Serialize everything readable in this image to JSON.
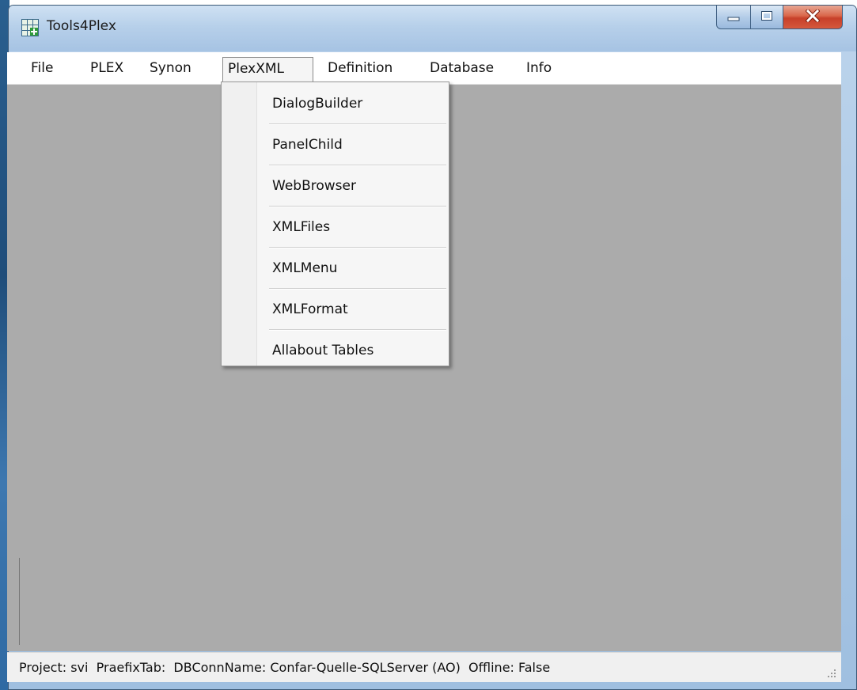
{
  "window": {
    "title": "Tools4Plex",
    "controls": {
      "minimize": "minimize",
      "maximize": "maximize",
      "close": "close"
    }
  },
  "menubar": {
    "items": [
      {
        "label": "File"
      },
      {
        "label": "PLEX"
      },
      {
        "label": "Synon"
      },
      {
        "label": "PlexXML",
        "open": true
      },
      {
        "label": "Definition"
      },
      {
        "label": "Database"
      },
      {
        "label": "Info"
      }
    ]
  },
  "dropdown": {
    "items": [
      {
        "label": "DialogBuilder"
      },
      {
        "label": "PanelChild"
      },
      {
        "label": "WebBrowser"
      },
      {
        "label": "XMLFiles"
      },
      {
        "label": "XMLMenu"
      },
      {
        "label": "XMLFormat"
      },
      {
        "label": "Allabout Tables"
      }
    ]
  },
  "statusbar": {
    "text": "Project: svi  PraefixTab:  DBConnName: Confar-Quelle-SQLServer (AO)  Offline: False"
  },
  "colors": {
    "client_background": "#ababab",
    "close_button": "#c7402a",
    "titlebar": "#b7d0ea"
  },
  "icons": {
    "app": "grid-table-icon",
    "minimize": "minimize-icon",
    "maximize": "maximize-icon",
    "close": "close-icon",
    "grip": "resize-grip-icon"
  }
}
